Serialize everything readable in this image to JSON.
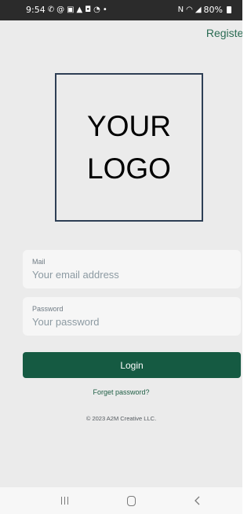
{
  "status_bar": {
    "time": "9:54",
    "notification_icons": [
      "messenger-icon",
      "threads-icon",
      "w-app-icon",
      "alert-icon",
      "podcast-icon",
      "record-icon"
    ],
    "more_dot": "•",
    "nfc": "N",
    "battery": "80%"
  },
  "header": {
    "register_label": "Register"
  },
  "logo": {
    "line1": "YOUR",
    "line2": "LOGO"
  },
  "form": {
    "mail_label": "Mail",
    "mail_placeholder": "Your email address",
    "password_label": "Password",
    "password_placeholder": "Your password",
    "login_label": "Login",
    "forgot_label": "Forget password?"
  },
  "footer": {
    "copyright": "© 2023 A2M Creative LLC."
  },
  "colors": {
    "accent": "#155a42",
    "background": "#ebebeb",
    "link": "#2a6b52"
  }
}
